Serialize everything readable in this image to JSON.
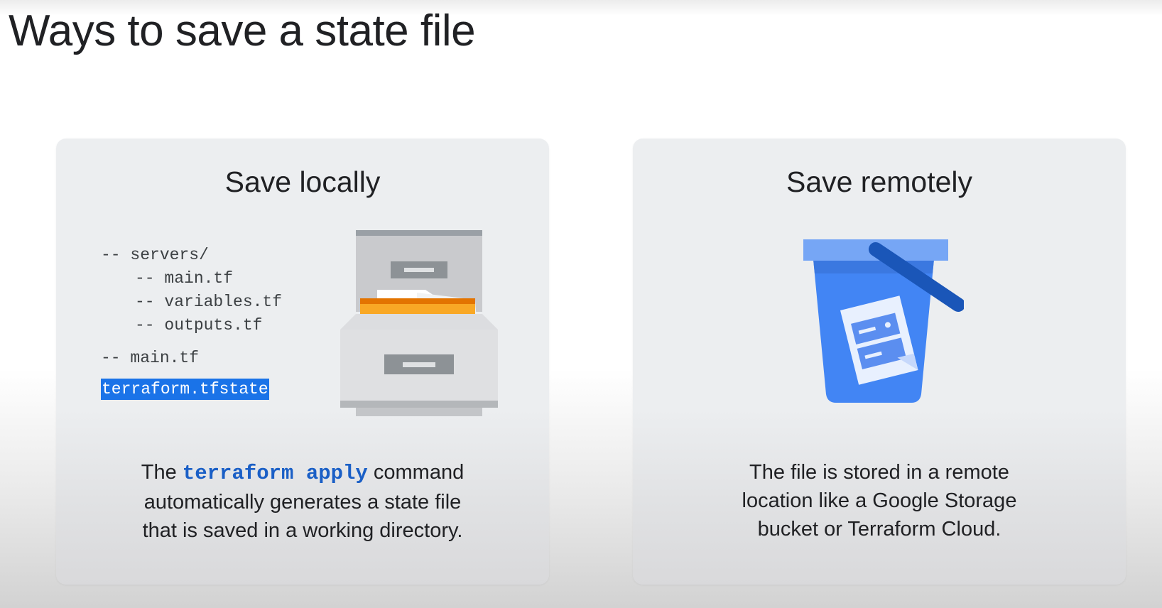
{
  "slide": {
    "title": "Ways to save a state file"
  },
  "local": {
    "heading": "Save locally",
    "tree": {
      "servers": "-- servers/",
      "servers_main": "-- main.tf",
      "servers_variables": "-- variables.tf",
      "servers_outputs": "-- outputs.tf",
      "main": "-- main.tf",
      "state_file": "terraform.tfstate"
    },
    "icon": "file-cabinet-icon",
    "description": {
      "prefix": "The",
      "command": "terraform apply",
      "suffix": " command",
      "line2": "automatically generates a state file",
      "line3": "that is saved in a working directory."
    }
  },
  "remote": {
    "heading": "Save remotely",
    "icon": "storage-bucket-icon",
    "description": {
      "line1": "The file is stored in a remote",
      "line2": "location like a Google Storage",
      "line3": "bucket or Terraform Cloud."
    }
  },
  "colors": {
    "highlight": "#1a73e8",
    "code_text": "#1a5fc6",
    "folder": "#f9a825",
    "bucket": "#4285f4"
  }
}
